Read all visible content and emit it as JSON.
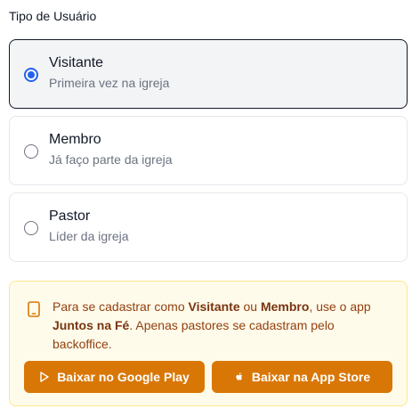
{
  "section": {
    "label": "Tipo de Usuário"
  },
  "options": [
    {
      "title": "Visitante",
      "subtitle": "Primeira vez na igreja",
      "selected": true
    },
    {
      "title": "Membro",
      "subtitle": "Já faço parte da igreja",
      "selected": false
    },
    {
      "title": "Pastor",
      "subtitle": "Líder da igreja",
      "selected": false
    }
  ],
  "notice": {
    "part1": "Para se cadastrar como ",
    "bold1": "Visitante",
    "part2": " ou ",
    "bold2": "Membro",
    "part3": ", use o app ",
    "bold3": "Juntos na Fé",
    "part4": ". Apenas pastores se cadastram pelo backoffice.",
    "icon": "smartphone-icon"
  },
  "buttons": {
    "google_play": "Baixar no Google Play",
    "app_store": "Baixar na App Store"
  },
  "colors": {
    "accent": "#2563eb",
    "notice_bg": "#fffbeb",
    "notice_text": "#92400e",
    "button_bg": "#d97706"
  }
}
